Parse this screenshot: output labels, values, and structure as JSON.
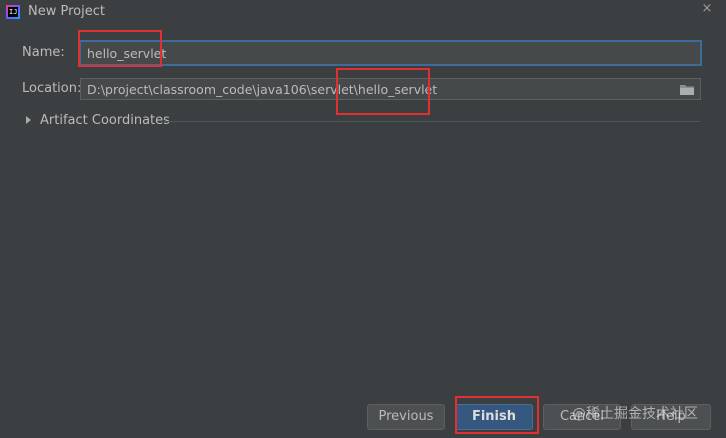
{
  "window": {
    "title": "New Project",
    "app_icon_text": "IJ",
    "close_glyph": "×"
  },
  "form": {
    "name_label": "Name:",
    "name_value": "hello_servlet",
    "location_label": "Location:",
    "location_value": "D:\\project\\classroom_code\\java106\\servlet\\hello_servlet"
  },
  "artifact": {
    "label": "Artifact Coordinates",
    "expanded": false
  },
  "buttons": {
    "previous": "Previous",
    "finish": "Finish",
    "cancel": "Cancel",
    "help": "Help"
  },
  "watermark": "@稀土掘金技术社区",
  "icons": {
    "app": "intellij-icon",
    "close": "close-icon",
    "folder": "folder-icon",
    "expand": "chevron-right-icon"
  },
  "colors": {
    "background": "#3c3f41",
    "input_background": "#45494a",
    "focus_border": "#3f6b9a",
    "default_button": "#365880",
    "annotation": "#e03030"
  }
}
